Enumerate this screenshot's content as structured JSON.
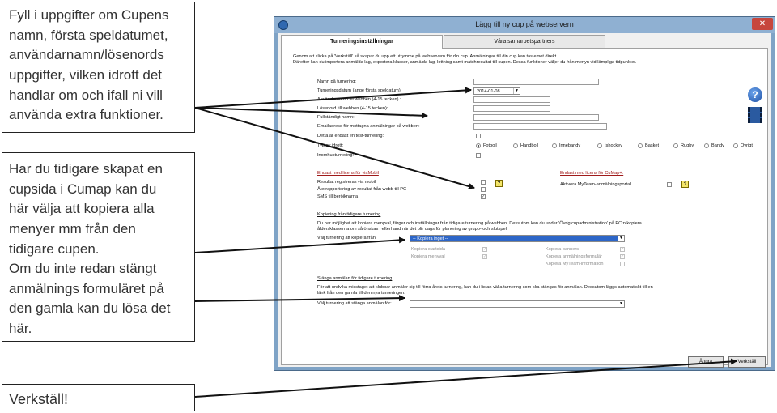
{
  "callouts": {
    "first": [
      "Fyll i uppgifter om Cupens",
      "namn, första speldatumet,",
      "användarnamn/lösenords",
      "uppgifter, vilken idrott det",
      "handlar om och ifall ni vill",
      "använda extra funktioner."
    ],
    "second": [
      "Har du tidigare skapat en",
      "cupsida i Cumap kan du",
      "här välja att kopiera alla",
      "menyer mm från den",
      "tidigare cupen.",
      "Om du inte redan stängt",
      "anmälnings formuläret på",
      "den gamla kan du lösa det",
      "här."
    ],
    "third": "Verkställ!"
  },
  "window": {
    "title": "Lägg till ny cup på webservern",
    "close": "✕",
    "tabs": [
      "Turneringsinställningar",
      "Våra samarbetspartners"
    ],
    "intro": [
      "Genom att klicka på 'Verkställ' så skapar du upp ett utrymme på webservern för din cup. Anmälningar till din cup kan tas emot direkt.",
      "Därefter kan du importera anmälda lag, exportera klasser, anmälda lag, lottning samt matchresultat till cupen. Dessa funktioner väljer du från menyn vid lämpliga tidpunkter."
    ],
    "form": {
      "name_label": "Namn på turnering:",
      "date_label": "Turneringsdatum (ange första speldatum):",
      "date_value": "2014-01-08",
      "user_label": "Användarnamn till webben (4-15 tecken) :",
      "pass_label": "Lösenord till webben (4-15 tecken):",
      "fullname_label": "Fullständigt namn:",
      "email_label": "Emailadress för mottagna anmälningar på webben:",
      "test_label": "Detta är endast en test-turnering:",
      "sport_label": "Typ av idrott:",
      "indoor_label": "Inomhusturnering:",
      "sports": [
        "Fotboll",
        "Handboll",
        "Innebandy",
        "Ishockey",
        "Basket",
        "Rugby",
        "Bandy",
        "Övrigt"
      ]
    },
    "license_left": {
      "heading": "Endast med licens för viaMobil",
      "items": [
        "Resultat registreras via mobil",
        "Återrapportering av resultat från webb till PC",
        "SMS till beröiknarna"
      ]
    },
    "license_right": {
      "heading": "Endast med licens för CuMap+:",
      "item": "Aktivera MyTeam-anmälningsportal"
    },
    "copy": {
      "heading": "Kopiering från tidigare turnering",
      "text": [
        "Du har möjlighet att kopiera menyval, färger och inställningar från tidigare turnering på webben. Dessutom kan du under 'Övrig cupadministration' på PC:n kopiera",
        "åldersklasserna om så önskas i efterhand när det blir dags för planering av grupp- och slutspel."
      ],
      "select_label": "Välj turnering att kopiera från:",
      "select_value": "-- Kopiera inget --",
      "options_left": [
        "Kopiera startsida",
        "Kopiera menyval"
      ],
      "options_right": [
        "Kopiera banners",
        "Kopiera anmälningsformulär",
        "Kopiera MyTeam-information"
      ]
    },
    "close_reg": {
      "heading": "Stänga anmälan för tidigare turnering",
      "text": [
        "För att undvika misstaget att klubbar anmäler sig till förra årets turnering, kan du i listan välja turnering som ska stängas för anmälan. Dessutom läggs automatiskt till en",
        "länk från den gamla till den nya turneringen."
      ],
      "select_label": "Välj turnering att stänga anmälan för:",
      "select_value": ""
    },
    "buttons": {
      "cancel": "Ångra",
      "apply": "Verkställ"
    }
  },
  "colors": {
    "titlebar": "#8fb0d2",
    "highlight": "#2d66c8",
    "close": "#c7463d"
  }
}
